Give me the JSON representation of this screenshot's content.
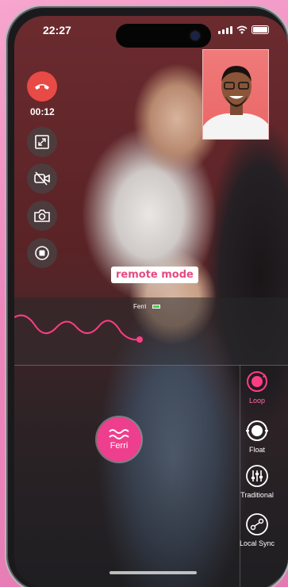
{
  "status": {
    "time": "22:27",
    "icons": [
      "signal-icon",
      "wifi-icon",
      "battery-icon"
    ]
  },
  "call": {
    "timer": "00:12"
  },
  "overlay": {
    "mode_label": "remote mode"
  },
  "device": {
    "name": "Ferri"
  },
  "modes": [
    {
      "label": "Loop",
      "icon": "loop-icon",
      "active": true
    },
    {
      "label": "Float",
      "icon": "float-icon",
      "active": false
    },
    {
      "label": "Traditional",
      "icon": "sliders-icon",
      "active": false
    },
    {
      "label": "Local Sync",
      "icon": "sync-icon",
      "active": false
    }
  ],
  "toy_button": {
    "label": "Ferri"
  },
  "colors": {
    "accent": "#ee3f8e",
    "end_call": "#e84a46",
    "mode_text": "#e54a82",
    "battery": "#3bd34a"
  }
}
